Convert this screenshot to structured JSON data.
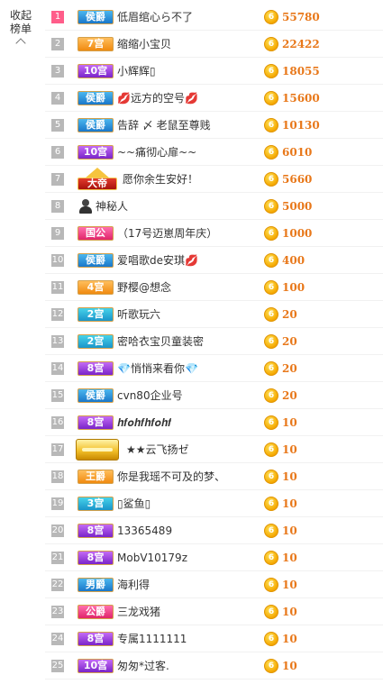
{
  "panel": {
    "collapse_label": "收起榜单"
  },
  "colors": {
    "rank_top": "#ff5d8a",
    "rank_default": "#b8b8b8",
    "score": "#e8781a",
    "coin": "#f5a800"
  },
  "coin_icon": "6",
  "rows": [
    {
      "rank": "1",
      "badge_label": "侯爵",
      "badge_color": "blue",
      "badge_type": "badge",
      "name": "低眉绾心ら不了",
      "score": "55780",
      "top": true
    },
    {
      "rank": "2",
      "badge_label": "7宫",
      "badge_color": "orange",
      "badge_type": "badge",
      "name": "缩缩小宝贝",
      "score": "22422"
    },
    {
      "rank": "3",
      "badge_label": "10宫",
      "badge_color": "purple",
      "badge_type": "badge",
      "name": "小辉辉▯",
      "score": "18055"
    },
    {
      "rank": "4",
      "badge_label": "侯爵",
      "badge_color": "blue",
      "badge_type": "badge",
      "name": "💋远方的空号💋",
      "score": "15600"
    },
    {
      "rank": "5",
      "badge_label": "侯爵",
      "badge_color": "blue",
      "badge_type": "badge",
      "name": "告辞 〆 老鼠至尊贱",
      "score": "10130"
    },
    {
      "rank": "6",
      "badge_label": "10宫",
      "badge_color": "purple",
      "badge_type": "badge",
      "name": "~~痛彻心扉~~",
      "score": "6010"
    },
    {
      "rank": "7",
      "badge_label": "大帝",
      "badge_color": "red",
      "badge_type": "crown",
      "name": "愿你余生安好！",
      "score": "5660"
    },
    {
      "rank": "8",
      "badge_label": "",
      "badge_color": "",
      "badge_type": "avatar",
      "name": "神秘人",
      "score": "5000"
    },
    {
      "rank": "9",
      "badge_label": "国公",
      "badge_color": "pink",
      "badge_type": "badge",
      "name": "（17号迈崽周年庆）",
      "score": "1000"
    },
    {
      "rank": "10",
      "badge_label": "侯爵",
      "badge_color": "blue",
      "badge_type": "badge",
      "name": "爱唱歌de安琪💋",
      "score": "400"
    },
    {
      "rank": "11",
      "badge_label": "4宫",
      "badge_color": "orange",
      "badge_type": "badge",
      "name": "野樱@想念",
      "score": "100"
    },
    {
      "rank": "12",
      "badge_label": "2宫",
      "badge_color": "cyan",
      "badge_type": "badge",
      "name": "听歌玩六",
      "score": "20"
    },
    {
      "rank": "13",
      "badge_label": "2宫",
      "badge_color": "cyan",
      "badge_type": "badge",
      "name": "密哈衣宝贝童装密",
      "score": "20"
    },
    {
      "rank": "14",
      "badge_label": "8宫",
      "badge_color": "purple",
      "badge_type": "badge",
      "name": "💎悄悄来看你💎",
      "score": "20"
    },
    {
      "rank": "15",
      "badge_label": "侯爵",
      "badge_color": "blue",
      "badge_type": "badge",
      "name": "cvn80企业号",
      "score": "20"
    },
    {
      "rank": "16",
      "badge_label": "8宫",
      "badge_color": "purple",
      "badge_type": "badge",
      "name": "𝒉𝒇𝒐𝒉𝒇𝒉𝒇𝒐𝒉𝒇",
      "score": "10"
    },
    {
      "rank": "17",
      "badge_label": "",
      "badge_color": "gold",
      "badge_type": "gold",
      "name": "★★云飞扬ゼ",
      "score": "10"
    },
    {
      "rank": "18",
      "badge_label": "王爵",
      "badge_color": "orange",
      "badge_type": "badge",
      "name": "你是我瑶不可及的梦、",
      "score": "10"
    },
    {
      "rank": "19",
      "badge_label": "3宫",
      "badge_color": "cyan",
      "badge_type": "badge",
      "name": "▯鲨鱼▯",
      "score": "10"
    },
    {
      "rank": "20",
      "badge_label": "8宫",
      "badge_color": "purple",
      "badge_type": "badge",
      "name": "13365489",
      "score": "10"
    },
    {
      "rank": "21",
      "badge_label": "8宫",
      "badge_color": "purple",
      "badge_type": "badge",
      "name": "MobV10179z",
      "score": "10"
    },
    {
      "rank": "22",
      "badge_label": "男爵",
      "badge_color": "blue",
      "badge_type": "badge",
      "name": "海利得",
      "score": "10"
    },
    {
      "rank": "23",
      "badge_label": "公爵",
      "badge_color": "pink",
      "badge_type": "badge",
      "name": "三龙戏猪",
      "score": "10"
    },
    {
      "rank": "24",
      "badge_label": "8宫",
      "badge_color": "purple",
      "badge_type": "badge",
      "name": "专属1111111",
      "score": "10"
    },
    {
      "rank": "25",
      "badge_label": "10宫",
      "badge_color": "purple",
      "badge_type": "badge",
      "name": "匆匆*过客.",
      "score": "10"
    }
  ]
}
